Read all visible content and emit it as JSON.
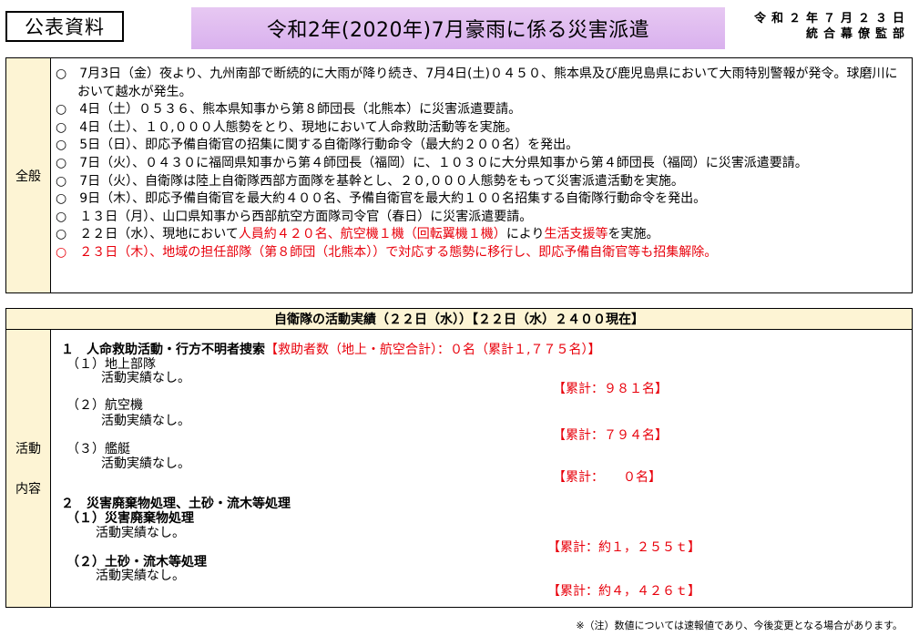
{
  "header": {
    "badge": "公表資料",
    "title": "令和2年(2020年)7月豪雨に係る災害派遣",
    "date_line1": "令和２年７月２３日",
    "date_line2": "統合幕僚監部",
    "title_bg": "#dcb6ef"
  },
  "general": {
    "label": "全般",
    "items": [
      {
        "bullet": "○",
        "text": "7月3日（金）夜より、九州南部で断続的に大雨が降り続き、7月4日(土)０４５０、熊本県及び鹿児島県において大雨特別警報が発令。球磨川において越水が発生。"
      },
      {
        "bullet": "○",
        "text": "4日（土）０５３６、熊本県知事から第８師団長（北熊本）に災害派遣要請。"
      },
      {
        "bullet": "○",
        "text": "4日（土）、１０,０００人態勢をとり、現地において人命救助活動等を実施。"
      },
      {
        "bullet": "○",
        "text": "5日（日）、即応予備自衛官の招集に関する自衛隊行動命令（最大約２００名）を発出。"
      },
      {
        "bullet": "○",
        "text": "7日（火）、０４３０に福岡県知事から第４師団長（福岡）に、１０３０に大分県知事から第４師団長（福岡）に災害派遣要請。"
      },
      {
        "bullet": "○",
        "text": "7日（火）、自衛隊は陸上自衛隊西部方面隊を基幹とし、２０,０００人態勢をもって災害派遣活動を実施。"
      },
      {
        "bullet": "○",
        "text": "9日（木）、即応予備自衛官を最大約４００名、予備自衛官を最大約１００名招集する自衛隊行動命令を発出。"
      },
      {
        "bullet": "○",
        "text": "１３日（月）、山口県知事から西部航空方面隊司令官（春日）に災害派遣要請。"
      },
      {
        "bullet": "○",
        "text_a": "２２日（水）、現地において",
        "text_b": "人員約４２０名、航空機１機（回転翼機１機）",
        "text_c": "により",
        "text_d": "生活支援等",
        "text_e": "を実施。"
      },
      {
        "bullet": "○",
        "text": "２３日（木）、地域の担任部隊（第８師団（北熊本））で対応する態勢に移行し、即応予備自衛官等も招集解除。"
      }
    ]
  },
  "activities": {
    "header": "自衛隊の活動実績（２２日（水））【２２日（水）２４００現在】",
    "label_1": "活動",
    "label_2": "内容",
    "rescue_title": "１　人命救助活動・行方不明者捜索",
    "rescue_total": "【救助者数（地上・航空合計）：０名（累計１,７７５名）】",
    "ground_label": "（１）地上部隊",
    "ground_text": "活動実績なし。",
    "ground_cum": "【累計：９８１名】",
    "air_label": "（２）航空機",
    "air_text": "活動実績なし。",
    "air_cum": "【累計：７９４名】",
    "ship_label": "（３）艦艇",
    "ship_text": "活動実績なし。",
    "ship_cum": "【累計：　　０名】",
    "waste_title": "２　災害廃棄物処理、土砂・流木等処理",
    "waste_label": "（１）災害廃棄物処理",
    "waste_text": "活動実績なし。",
    "waste_cum": "【累計：約１，２５５ｔ】",
    "soil_label": "（２）土砂・流木等処理",
    "soil_text": "活動実績なし。",
    "soil_cum": "【累計：約４，４２６ｔ】"
  },
  "note": "※（注）数値については速報値であり、今後変更となる場合があります。"
}
